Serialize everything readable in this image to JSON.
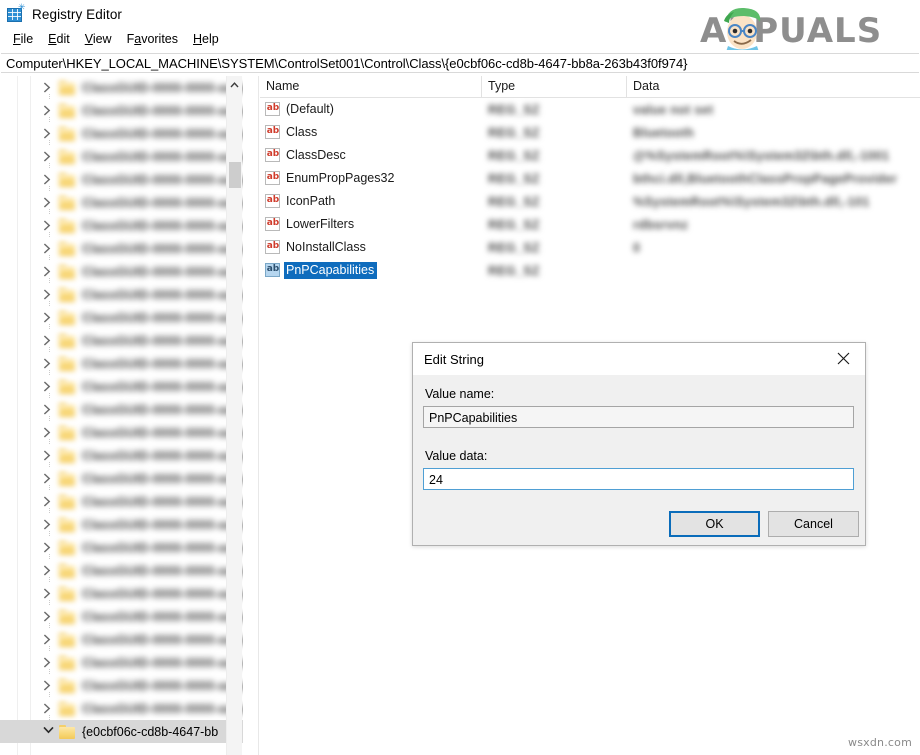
{
  "window": {
    "title": "Registry Editor",
    "icon": "registry-editor-icon"
  },
  "menu": {
    "items": [
      {
        "label": "File",
        "accesskey": "F"
      },
      {
        "label": "Edit",
        "accesskey": "E"
      },
      {
        "label": "View",
        "accesskey": "V"
      },
      {
        "label": "Favorites",
        "accesskey": "a"
      },
      {
        "label": "Help",
        "accesskey": "H"
      }
    ]
  },
  "address_bar": {
    "path": "Computer\\HKEY_LOCAL_MACHINE\\SYSTEM\\ControlSet001\\Control\\Class\\{e0cbf06c-cd8b-4647-bb8a-263b43f0f974}"
  },
  "tree": {
    "selected_key": "{e0cbf06c-cd8b-4647-bb",
    "scrollbar": {
      "up_arrow_icon": "chevron-up-icon",
      "thumb_position_pct": 13
    },
    "items": [
      {
        "label": "",
        "blurred": true,
        "expander": "chevron-right-icon"
      },
      {
        "label": "",
        "blurred": true,
        "expander": "chevron-right-icon"
      },
      {
        "label": "",
        "blurred": true,
        "expander": "chevron-right-icon"
      },
      {
        "label": "",
        "blurred": true,
        "expander": "chevron-right-icon"
      },
      {
        "label": "",
        "blurred": true,
        "expander": "chevron-right-icon"
      },
      {
        "label": "",
        "blurred": true,
        "expander": "chevron-right-icon"
      },
      {
        "label": "",
        "blurred": true,
        "expander": "chevron-right-icon"
      },
      {
        "label": "",
        "blurred": true,
        "expander": "chevron-right-icon"
      },
      {
        "label": "",
        "blurred": true,
        "expander": "chevron-right-icon"
      },
      {
        "label": "",
        "blurred": true,
        "expander": "chevron-right-icon"
      },
      {
        "label": "",
        "blurred": true,
        "expander": "chevron-right-icon"
      },
      {
        "label": "",
        "blurred": true,
        "expander": "chevron-right-icon"
      },
      {
        "label": "",
        "blurred": true,
        "expander": "chevron-right-icon"
      },
      {
        "label": "",
        "blurred": true,
        "expander": "chevron-right-icon"
      },
      {
        "label": "",
        "blurred": true,
        "expander": "chevron-right-icon"
      },
      {
        "label": "",
        "blurred": true,
        "expander": "chevron-right-icon"
      },
      {
        "label": "",
        "blurred": true,
        "expander": "chevron-right-icon"
      },
      {
        "label": "",
        "blurred": true,
        "expander": "chevron-right-icon"
      },
      {
        "label": "",
        "blurred": true,
        "expander": "chevron-right-icon"
      },
      {
        "label": "",
        "blurred": true,
        "expander": "chevron-right-icon"
      },
      {
        "label": "",
        "blurred": true,
        "expander": "chevron-right-icon"
      },
      {
        "label": "",
        "blurred": true,
        "expander": "chevron-right-icon"
      },
      {
        "label": "",
        "blurred": true,
        "expander": "chevron-right-icon"
      },
      {
        "label": "",
        "blurred": true,
        "expander": "chevron-right-icon"
      },
      {
        "label": "",
        "blurred": true,
        "expander": "chevron-right-icon"
      },
      {
        "label": "",
        "blurred": true,
        "expander": "chevron-right-icon"
      },
      {
        "label": "",
        "blurred": true,
        "expander": "chevron-right-icon"
      },
      {
        "label": "",
        "blurred": true,
        "expander": "chevron-right-icon"
      },
      {
        "label": "{e0cbf06c-cd8b-4647-bb",
        "blurred": false,
        "expander": "chevron-down-icon",
        "selected": true
      }
    ]
  },
  "values_list": {
    "columns": [
      "Name",
      "Type",
      "Data"
    ],
    "rows": [
      {
        "name": "(Default)",
        "type": "",
        "data": "",
        "icon": "ab-string-icon",
        "selected": false,
        "censored": true
      },
      {
        "name": "Class",
        "type": "",
        "data": "",
        "icon": "ab-string-icon",
        "selected": false,
        "censored": true
      },
      {
        "name": "ClassDesc",
        "type": "",
        "data": "",
        "icon": "ab-string-icon",
        "selected": false,
        "censored": true
      },
      {
        "name": "EnumPropPages32",
        "type": "",
        "data": "",
        "icon": "ab-string-icon",
        "selected": false,
        "censored": true
      },
      {
        "name": "IconPath",
        "type": "",
        "data": "",
        "icon": "ab-string-icon",
        "selected": false,
        "censored": true
      },
      {
        "name": "LowerFilters",
        "type": "",
        "data": "",
        "icon": "ab-string-icon",
        "selected": false,
        "censored": true
      },
      {
        "name": "NoInstallClass",
        "type": "",
        "data": "",
        "icon": "ab-string-icon",
        "selected": false,
        "censored": true
      },
      {
        "name": "PnPCapabilities",
        "type": "",
        "data": "",
        "icon": "ab-string-icon",
        "selected": true,
        "censored": true
      }
    ]
  },
  "edit_string_dialog": {
    "title": "Edit String",
    "close_icon": "close-icon",
    "value_name_label": "Value name:",
    "value_name": "PnPCapabilities",
    "value_data_label": "Value data:",
    "value_data": "24",
    "ok_label": "OK",
    "cancel_label": "Cancel"
  },
  "watermarks": {
    "brand": "APPUALS",
    "brand_icon": "appuals-mascot-icon",
    "site": "wsxdn.com"
  },
  "colors": {
    "selection_blue": "#0f6cbd",
    "focus_blue": "#0a6cba",
    "folder_yellow": "#f3c95a",
    "ab_icon_red": "#d03b2b",
    "dialog_bg": "#f0f0f0",
    "tree_selected_gray": "#d8d8d8",
    "watermark_gray": "#8a8a8a"
  }
}
